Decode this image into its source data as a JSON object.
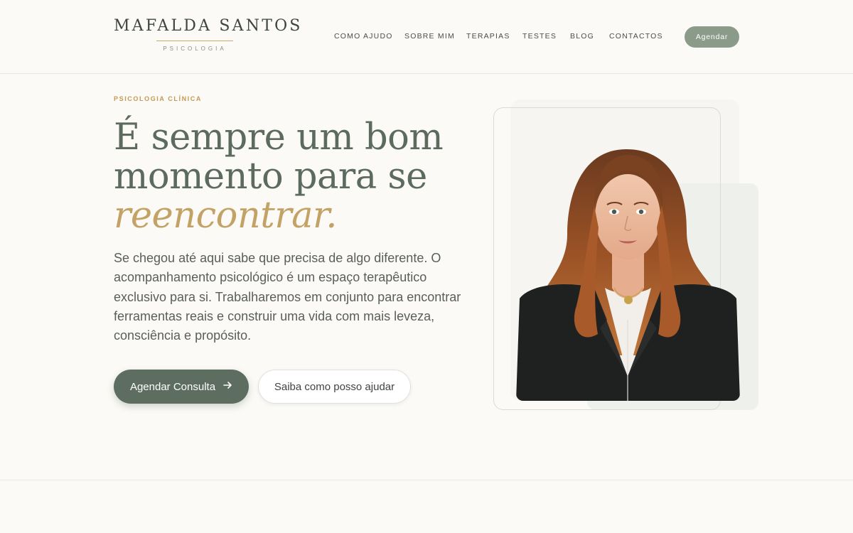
{
  "brand": {
    "name": "MAFALDA SANTOS",
    "subtitle": "PSICOLOGIA"
  },
  "nav": {
    "items": [
      {
        "label": "COMO AJUDO"
      },
      {
        "label": "SOBRE MIM"
      },
      {
        "label": "TERAPIAS"
      },
      {
        "label": "TESTES"
      },
      {
        "label": "BLOG"
      },
      {
        "label": "CONTACTOS"
      }
    ],
    "cta_label": "Agendar"
  },
  "hero": {
    "eyebrow": "PSICOLOGIA CLÍNICA",
    "headline_line1": "É sempre um bom",
    "headline_line2": "momento para se",
    "headline_accent": "reencontrar.",
    "lead": "Se chegou até aqui sabe que precisa de algo diferente. O acompanhamento psicológico é um espaço terapêutico exclusivo para si. Trabalharemos em conjunto para encontrar ferramentas reais e construir uma vida com mais leveza, consciência e propósito.",
    "primary_button": "Agendar Consulta",
    "primary_button_icon": "arrow-right-icon",
    "secondary_button": "Saiba como posso ajudar"
  },
  "colors": {
    "background": "#fbfaf6",
    "sage": "#5d6e60",
    "sage_light": "#8a9b8a",
    "gold": "#c3a265"
  }
}
